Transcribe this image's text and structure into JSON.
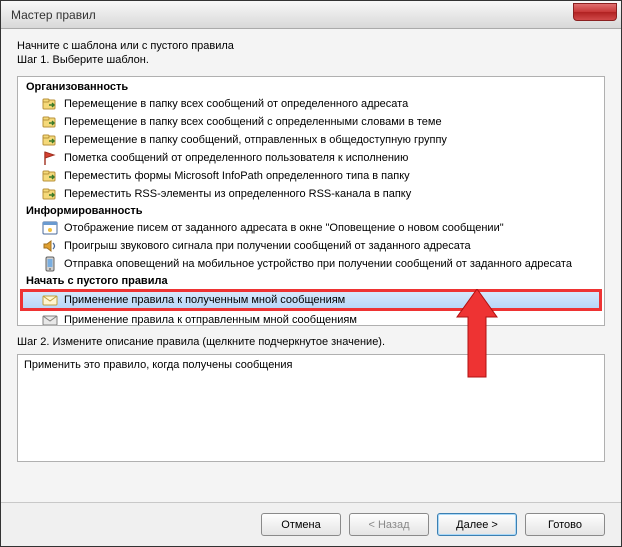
{
  "titlebar": {
    "title": "Мастер правил"
  },
  "intro": {
    "line1": "Начните с шаблона или с пустого правила",
    "line2": "Шаг 1. Выберите шаблон."
  },
  "groups": {
    "g1": "Организованность",
    "g2": "Информированность",
    "g3": "Начать с пустого правила"
  },
  "items": {
    "org1": "Перемещение в папку всех сообщений от определенного адресата",
    "org2": "Перемещение в папку всех сообщений с определенными словами в теме",
    "org3": "Перемещение в папку сообщений, отправленных в общедоступную группу",
    "org4": "Пометка сообщений от определенного пользователя к исполнению",
    "org5": "Переместить формы Microsoft InfoPath определенного типа в папку",
    "org6": "Переместить RSS-элементы из определенного RSS-канала в папку",
    "inf1": "Отображение писем от заданного адресата в окне \"Оповещение о новом сообщении\"",
    "inf2": "Проигрыш звукового сигнала при получении сообщений от заданного адресата",
    "inf3": "Отправка оповещений на мобильное устройство при получении сообщений от заданного адресата",
    "blank1": "Применение правила к полученным мной сообщениям",
    "blank2": "Применение правила к отправленным мной сообщениям"
  },
  "step2": {
    "label": "Шаг 2. Измените описание правила (щелкните подчеркнутое значение).",
    "desc": "Применить это правило, когда получены сообщения"
  },
  "buttons": {
    "cancel": "Отмена",
    "back": "< Назад",
    "next": "Далее >",
    "finish": "Готово"
  }
}
